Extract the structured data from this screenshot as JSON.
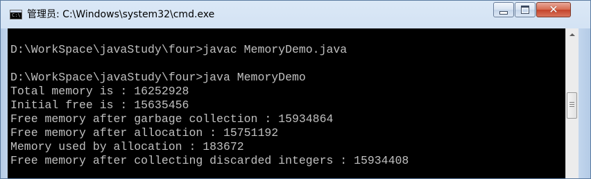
{
  "window": {
    "title": "管理员: C:\\Windows\\system32\\cmd.exe",
    "icon": "cmd-icon",
    "icon_text": "C:\\",
    "controls": {
      "minimize_icon": "minimize-icon",
      "maximize_icon": "maximize-icon",
      "close_icon": "close-icon",
      "close_glyph": "✕"
    }
  },
  "console": {
    "background": "#000000",
    "foreground": "#c0c0c0",
    "lines": [
      "",
      "D:\\WorkSpace\\javaStudy\\four>javac MemoryDemo.java",
      "",
      "D:\\WorkSpace\\javaStudy\\four>java MemoryDemo",
      "Total memory is : 16252928",
      "Initial free is : 15635456",
      "Free memory after garbage collection : 15934864",
      "Free memory after allocation : 15751192",
      "Memory used by allocation : 183672",
      "Free memory after collecting discarded integers : 15934408"
    ]
  },
  "scrollbar": {
    "up_icon": "scroll-up-icon"
  }
}
